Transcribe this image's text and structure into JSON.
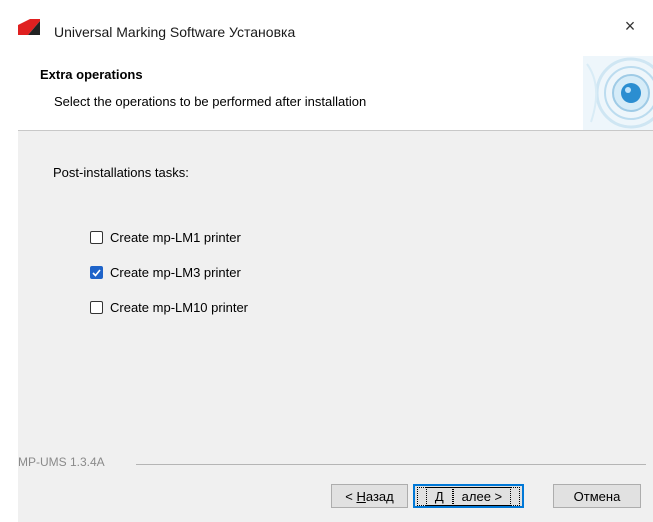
{
  "window": {
    "title": "Universal Marking Software Установка",
    "close_glyph": "×"
  },
  "header": {
    "title": "Extra operations",
    "subtitle": "Select the operations to be performed after installation"
  },
  "content": {
    "tasks_label": "Post-installations tasks:",
    "tasks": [
      {
        "label": "Create mp-LM1 printer",
        "checked": false
      },
      {
        "label": "Create mp-LM3 printer",
        "checked": true
      },
      {
        "label": "Create mp-LM10 printer",
        "checked": false
      }
    ]
  },
  "footer": {
    "version": "MP-UMS 1.3.4A",
    "back": {
      "prefix": "< ",
      "accel": "Н",
      "rest": "азад"
    },
    "next": {
      "accel": "Д",
      "rest": "алее >"
    },
    "cancel": "Отмена"
  },
  "colors": {
    "accent": "#1e63c9",
    "logo_red": "#e02020",
    "content_bg": "#f0f0f0"
  }
}
